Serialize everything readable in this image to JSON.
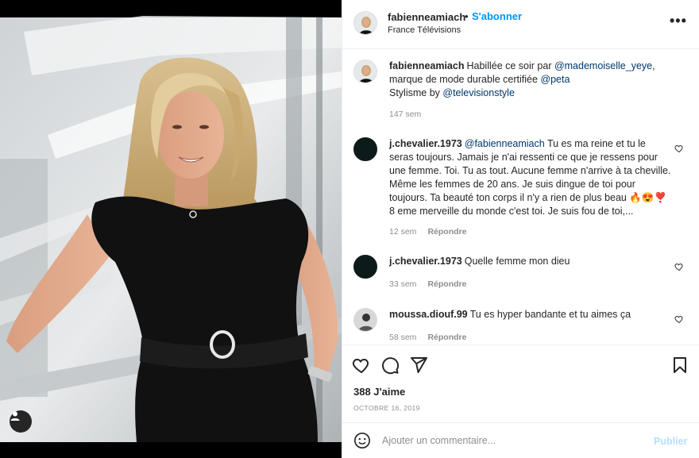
{
  "header": {
    "username": "fabienneamiach",
    "separator": "•",
    "follow_label": "S'abonner",
    "subtitle": "France Télévisions",
    "more_label": "•••"
  },
  "caption": {
    "username": "fabienneamiach",
    "text_1": "Habillée ce soir par ",
    "mention_1": "@mademoiselle_yeye",
    "text_2": ",",
    "text_3": "marque de mode durable certifiée ",
    "mention_2": "@peta",
    "text_4": "Stylisme by ",
    "mention_3": "@televisionstyle",
    "age": "147 sem"
  },
  "comments": [
    {
      "username": "j.chevalier.1973",
      "mention": "@fabienneamiach",
      "text": " Tu es ma reine et tu le seras toujours. Jamais je n'ai ressenti ce que je ressens pour une femme. Toi. Tu as tout. Aucune femme n'arrive à ta cheville. Même les femmes de 20 ans. Je suis dingue de toi pour toujours. Ta beauté ton corps il n'y a rien de plus beau 🔥😍❣️ 8 eme merveille du monde c'est toi. Je suis fou de toi,...",
      "age": "12 sem",
      "reply_label": "Répondre"
    },
    {
      "username": "j.chevalier.1973",
      "text": "Quelle femme mon dieu",
      "age": "33 sem",
      "reply_label": "Répondre"
    },
    {
      "username": "moussa.diouf.99",
      "text": "Tu es hyper bandante et tu aimes ça",
      "age": "58 sem",
      "reply_label": "Répondre"
    }
  ],
  "actions": {
    "likes": "388 J'aime",
    "date": "OCTOBRE 16, 2019"
  },
  "add_comment": {
    "placeholder": "Ajouter un commentaire...",
    "post_label": "Publier"
  },
  "colors": {
    "link_blue": "#0095f6",
    "mention_blue": "#00376b",
    "muted_gray": "#8e8e8e",
    "post_disabled": "#b2dffc"
  },
  "icons": [
    "user-tag-icon",
    "more-icon",
    "heart-icon",
    "comment-icon",
    "share-icon",
    "save-icon",
    "emoji-icon"
  ]
}
